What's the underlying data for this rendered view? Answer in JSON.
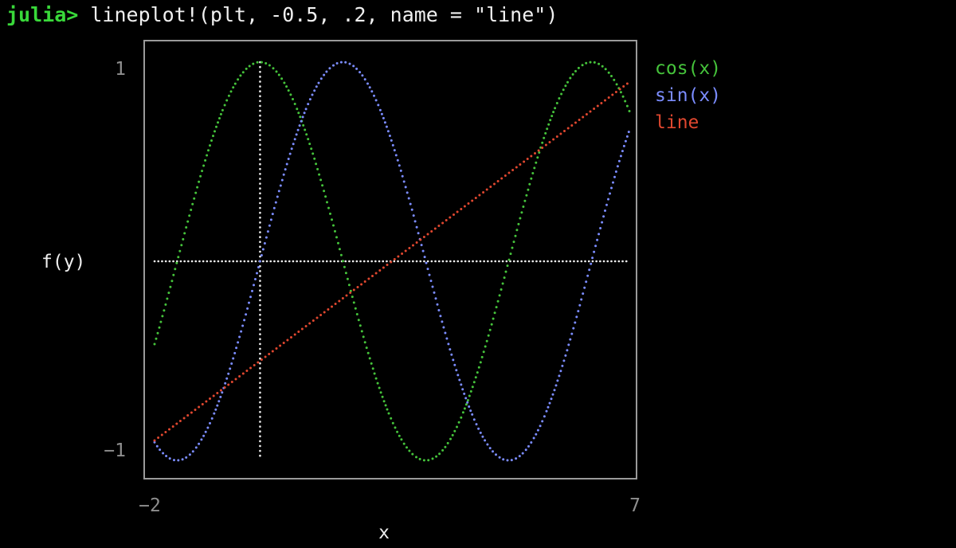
{
  "terminal": {
    "prompt": "julia>",
    "command": "lineplot!(plt, -0.5, .2, name = \"line\")"
  },
  "colors": {
    "background": "#000000",
    "prompt": "#39d93a",
    "frame": "#9a9a9a",
    "axis_lines": "#eeeeee"
  },
  "chart_data": {
    "type": "line",
    "xlabel": "x",
    "ylabel": "f(y)",
    "xlim": [
      -2,
      7
    ],
    "ylim": [
      -1,
      1
    ],
    "x_tick_labels": [
      "−2",
      "7"
    ],
    "y_tick_labels": [
      "1",
      "−1"
    ],
    "reference_lines": {
      "horizontal_y": 0,
      "vertical_x": 0
    },
    "legend_position": "right",
    "series": [
      {
        "name": "cos(x)",
        "color": "#45c33b",
        "function": "cos(x)"
      },
      {
        "name": "sin(x)",
        "color": "#7b8cff",
        "function": "sin(x)"
      },
      {
        "name": "line",
        "color": "#e0472f",
        "function": "-0.5 + 0.2*x"
      }
    ]
  }
}
